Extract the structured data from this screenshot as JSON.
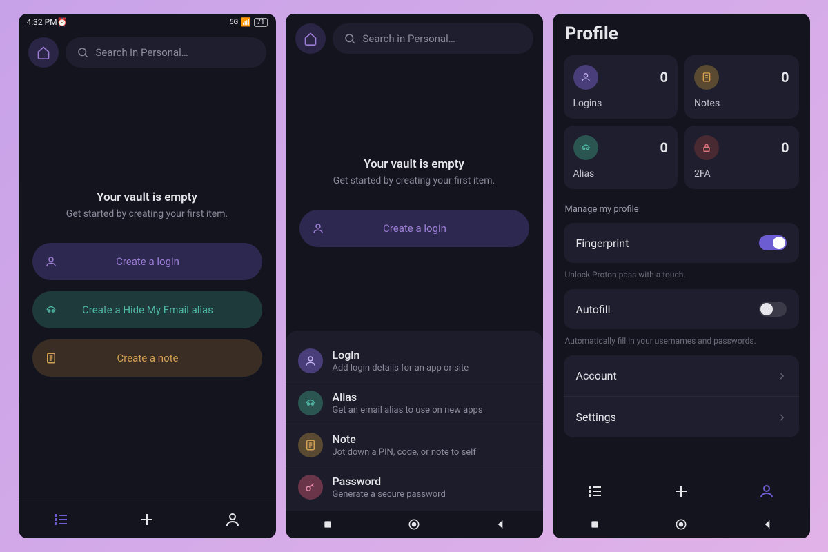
{
  "status": {
    "time": "4:32 PM",
    "battery": "71"
  },
  "search": {
    "placeholder": "Search in Personal…"
  },
  "empty": {
    "title": "Your vault is empty",
    "subtitle": "Get started by creating your first item."
  },
  "actions": {
    "login": "Create a login",
    "alias": "Create a Hide My Email alias",
    "note": "Create a note"
  },
  "sheet": {
    "login": {
      "title": "Login",
      "sub": "Add login details for an app or site"
    },
    "alias": {
      "title": "Alias",
      "sub": "Get an email alias to use on new apps"
    },
    "note": {
      "title": "Note",
      "sub": "Jot down a PIN, code, or note to self"
    },
    "password": {
      "title": "Password",
      "sub": "Generate a secure password"
    }
  },
  "profile": {
    "title": "Profile",
    "stats": {
      "logins": {
        "label": "Logins",
        "count": "0"
      },
      "notes": {
        "label": "Notes",
        "count": "0"
      },
      "alias": {
        "label": "Alias",
        "count": "0"
      },
      "twofa": {
        "label": "2FA",
        "count": "0"
      }
    },
    "manage": "Manage my profile",
    "fingerprint": {
      "label": "Fingerprint",
      "caption": "Unlock Proton pass with a touch."
    },
    "autofill": {
      "label": "Autofill",
      "caption": "Automatically fill in your usernames and passwords."
    },
    "account": "Account",
    "settings": "Settings"
  }
}
